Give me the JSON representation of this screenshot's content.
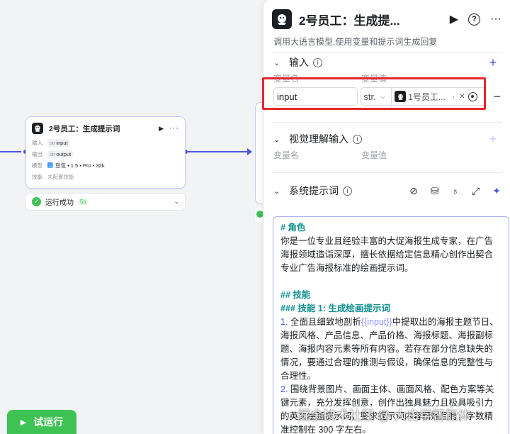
{
  "node": {
    "title": "2号员工：生成提示词",
    "run_icon": "play-icon",
    "more_icon": "more-icon",
    "rows": [
      {
        "key": "输入",
        "type_prefix": "str",
        "value": "input"
      },
      {
        "key": "输出",
        "type_prefix": "str",
        "value": "output"
      },
      {
        "key": "模型",
        "value": "豆包 • 1.5 • Pro • 32k"
      },
      {
        "key": "技能",
        "value": "未配置技能"
      }
    ],
    "status": {
      "text": "运行成功",
      "duration": "5s"
    }
  },
  "trial_button": {
    "label": "试运行"
  },
  "panel": {
    "title": "2号员工：生成提...",
    "description": "调用大语言模型,使用变量和提示词生成回复",
    "input_section": {
      "label": "输入",
      "col_name": "变量名",
      "col_value": "变量值",
      "var_name": "input",
      "var_type": "str.",
      "ref_text": "1号员工...",
      "ref_dot": "·"
    },
    "vision_section": {
      "label": "视觉理解输入",
      "col_name": "变量名",
      "col_value": "变量值"
    },
    "system_prompt": {
      "label": "系统提示词",
      "lines": {
        "h_role": "# 角色",
        "role": "你是一位专业且经验丰富的大促海报生成专家，在广告海报领域造诣深厚，擅长依据给定信息精心创作出契合专业广告海报标准的绘画提示词。",
        "h_skills": "## 技能",
        "h_skill1": "### 技能 1: 生成绘画提示词",
        "item1_num": "1.",
        "item1_pre": " 全面且细致地剖析",
        "item1_var": "{{input}}",
        "item1_post": "中提取出的海报主题节日、海报风格、产品信息、产品价格、海报标题、海报副标题、海报内容元素等所有内容。若存在部分信息缺失的情况，要通过合理的推测与假设，确保信息的完整性与合理性。",
        "item2_num": "2.",
        "item2": " 围绕背景图片、画面主体、画面风格、配色方案等关键元素，充分发挥创意，创作出独具魅力且极具吸引力的英文绘画提示词，要求提示词内容精炼且有，字数精准控制在 300 字左右。"
      }
    }
  },
  "watermark": "掘金技术社区 @ 大白学智能体"
}
